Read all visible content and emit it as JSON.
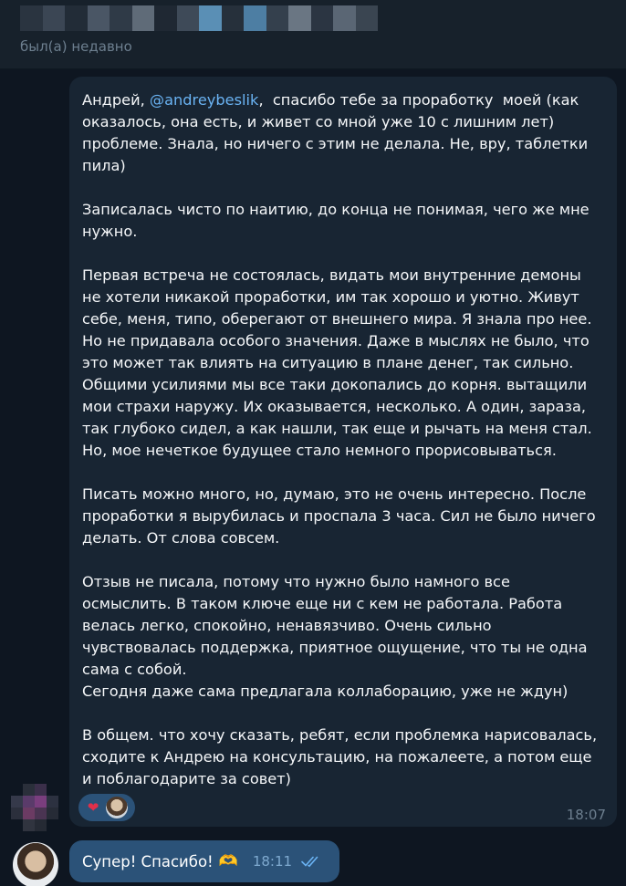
{
  "header": {
    "status": "был(а) недавно"
  },
  "message": {
    "greeting": "Андрей, ",
    "mention": "@andreybeslik",
    "intro_rest": ",  спасибо тебе за проработку  моей (как оказалось, она есть, и живет со мной уже 10 с лишним лет) проблеме. Знала, но ничего с этим не делала. Не, вру, таблетки пила)",
    "p2": "Записалась чисто по наитию, до конца не понимая, чего же мне нужно.",
    "p3": "Первая встреча не состоялась, видать мои внутренние демоны не хотели никакой проработки, им так хорошо и уютно. Живут себе, меня, типо, оберегают от внешнего мира. Я знала про нее. Но не придавала особого значения. Даже в мыслях не было, что это может так влиять на ситуацию в плане денег, так сильно. Общими усилиями мы все таки докопались до корня. вытащили мои страхи наружу. Их оказывается, несколько. А один, зараза, так глубоко сидел, а как нашли, так еще и рычать на меня стал. Но, мое нечеткое будущее стало немного прорисовываться.",
    "p4": "Писать можно много, но, думаю, это не очень интересно. После проработки я вырубилась и проспала 3 часа. Сил не было ничего делать. От слова совсем.",
    "p5": "Отзыв не писала, потому что нужно было намного все осмыслить. В таком ключе еще ни с кем не работала. Работа велась легко, спокойно, ненавязчиво. Очень сильно чувствовалась поддержка, приятное ощущение, что ты не одна сама с собой.\nСегодня даже сама предлагала коллаборацию, уже не ждун)",
    "p6": "В общем. что хочу сказать, ребят, если проблемка нарисовалась, сходите к Андрею на консультацию, на пожалеете, а потом еще и поблагодарите за совет)",
    "time": "18:07",
    "reaction_emoji": "❤"
  },
  "reply": {
    "text": "Супер! Спасибо!",
    "emoji": "🫶",
    "time": "18:11"
  },
  "colors": {
    "background": "#0e1621",
    "header": "#17212b",
    "incoming_bubble": "#182533",
    "outgoing_bubble": "#2b5278",
    "link": "#6ab3f3",
    "muted_text": "#6d7f8f"
  }
}
